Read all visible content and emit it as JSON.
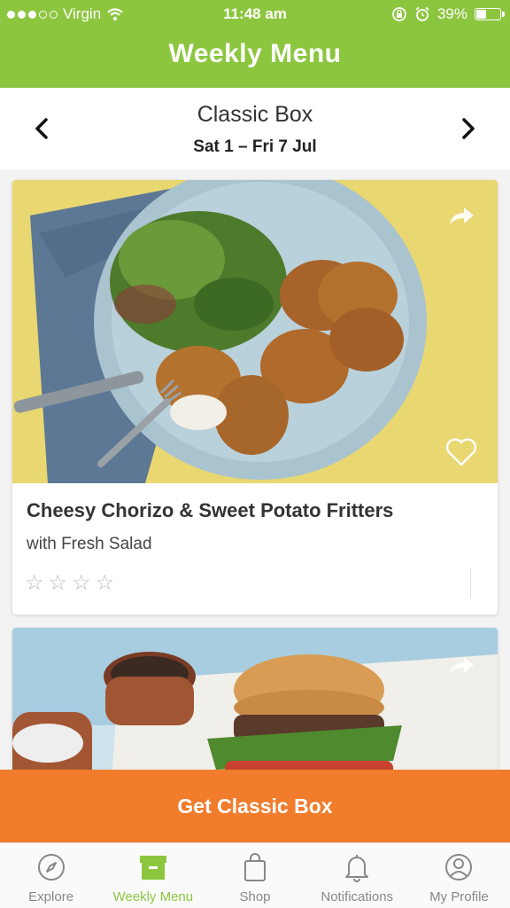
{
  "status": {
    "carrier": "Virgin",
    "time": "11:48 am",
    "battery": "39%"
  },
  "header": {
    "title": "Weekly Menu"
  },
  "selector": {
    "box_name": "Classic Box",
    "dates": "Sat 1 – Fri 7 Jul"
  },
  "recipes": [
    {
      "title": "Cheesy Chorizo & Sweet Potato Fritters",
      "subtitle": "with Fresh Salad",
      "rating_stars": 4
    },
    {
      "title": "",
      "subtitle": ""
    }
  ],
  "cta": {
    "label": "Get Classic Box"
  },
  "tabs": [
    {
      "label": "Explore",
      "icon": "compass-icon"
    },
    {
      "label": "Weekly Menu",
      "icon": "box-icon",
      "active": true
    },
    {
      "label": "Shop",
      "icon": "bag-icon"
    },
    {
      "label": "Notifications",
      "icon": "bell-icon"
    },
    {
      "label": "My Profile",
      "icon": "profile-icon"
    }
  ],
  "colors": {
    "brand_green": "#8cc63f",
    "cta_orange": "#f07c2c"
  }
}
